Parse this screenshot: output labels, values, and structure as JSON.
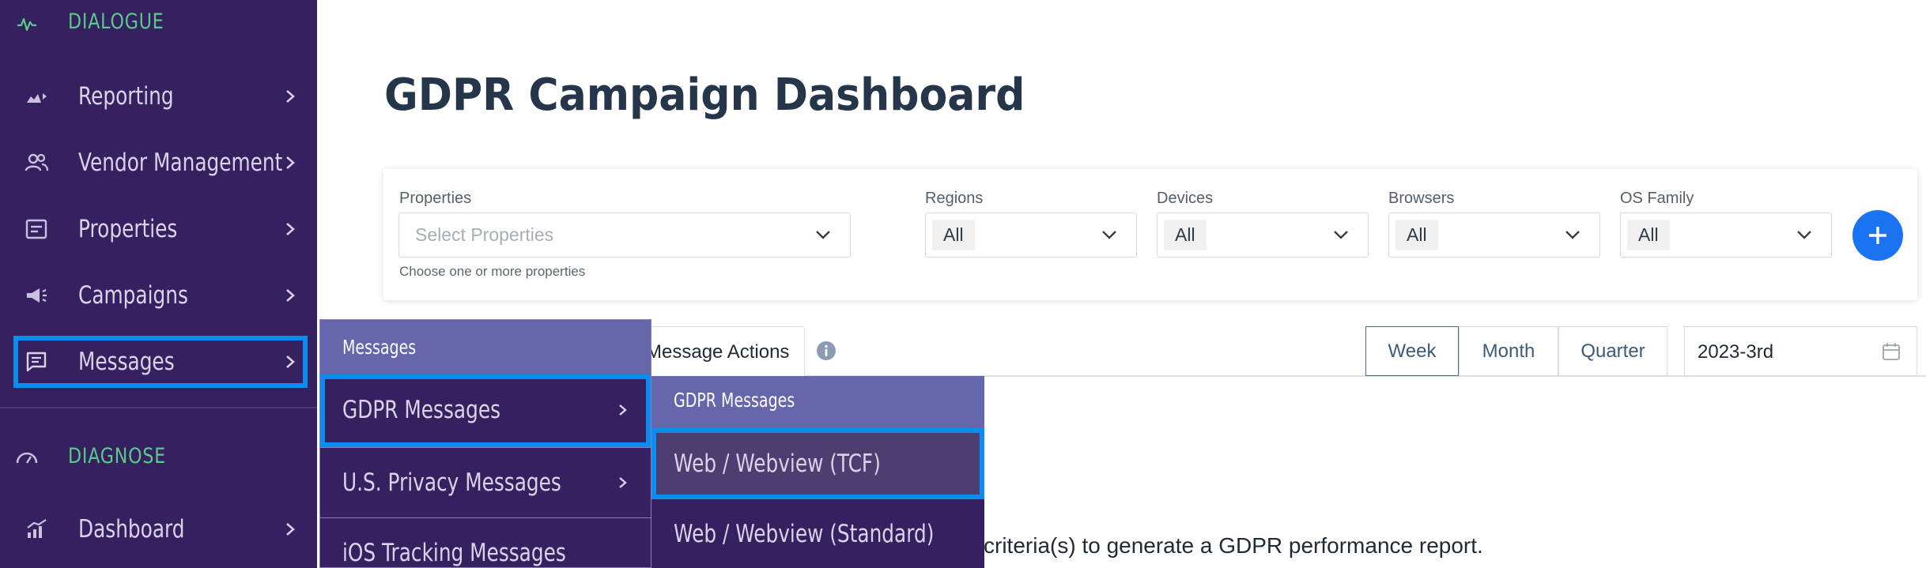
{
  "sidebar": {
    "sections": [
      {
        "label": "DIALOGUE",
        "icon": "activity-icon"
      },
      {
        "label": "DIAGNOSE",
        "icon": "gauge-icon"
      }
    ],
    "items": [
      {
        "label": "Reporting",
        "icon": "reporting-icon"
      },
      {
        "label": "Vendor Management",
        "icon": "people-icon"
      },
      {
        "label": "Properties",
        "icon": "properties-icon"
      },
      {
        "label": "Campaigns",
        "icon": "megaphone-icon"
      },
      {
        "label": "Messages",
        "icon": "message-icon",
        "selected": true
      },
      {
        "label": "Dashboard",
        "icon": "chart-up-icon"
      }
    ]
  },
  "page": {
    "title": "GDPR Campaign Dashboard"
  },
  "filters": {
    "properties": {
      "label": "Properties",
      "placeholder": "Select Properties",
      "help": "Choose one or more properties"
    },
    "regions": {
      "label": "Regions",
      "value": "All"
    },
    "devices": {
      "label": "Devices",
      "value": "All"
    },
    "browsers": {
      "label": "Browsers",
      "value": "All"
    },
    "os_family": {
      "label": "OS Family",
      "value": "All"
    }
  },
  "tabs": {
    "message_actions": "Message Actions"
  },
  "period": {
    "options": [
      "Week",
      "Month",
      "Quarter"
    ],
    "active": "Week"
  },
  "date_picker": {
    "value": "2023-3rd"
  },
  "report_hint": "criteria(s) to generate a GDPR performance report.",
  "flyout_messages": {
    "header": "Messages",
    "items": [
      "GDPR Messages",
      "U.S. Privacy Messages",
      "iOS Tracking Messages"
    ]
  },
  "flyout_gdpr": {
    "header": "GDPR Messages",
    "items": [
      "Web / Webview (TCF)",
      "Web / Webview (Standard)"
    ]
  },
  "colors": {
    "sidebar_bg": "#35215f",
    "accent_green": "#5dc98a",
    "selection_blue": "#0a8cf0",
    "add_button": "#1a73f0"
  }
}
